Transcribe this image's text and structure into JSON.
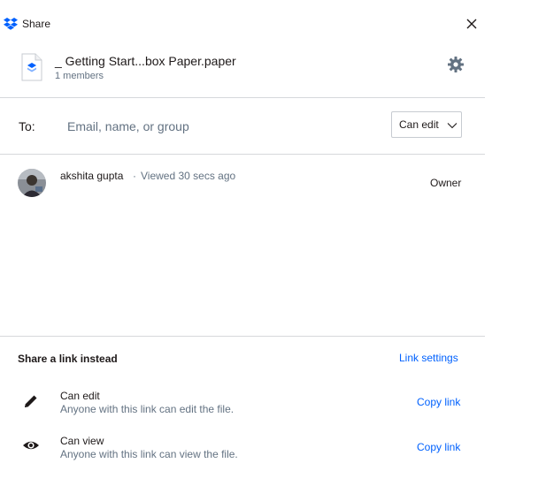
{
  "window": {
    "title": "Share"
  },
  "file": {
    "name": "_ Getting Start...box Paper.paper",
    "members": "1 members"
  },
  "to": {
    "label": "To:",
    "placeholder": "Email, name, or group",
    "permission": "Can edit"
  },
  "members": [
    {
      "name": "akshita gupta",
      "separator": "·",
      "status": "Viewed 30 secs ago",
      "role": "Owner"
    }
  ],
  "link_section": {
    "heading": "Share a link instead",
    "settings_label": "Link settings",
    "options": [
      {
        "title": "Can edit",
        "description": "Anyone with this link can edit the file.",
        "action": "Copy link",
        "icon": "pencil-icon"
      },
      {
        "title": "Can view",
        "description": "Anyone with this link can view the file.",
        "action": "Copy link",
        "icon": "eye-icon"
      }
    ]
  },
  "colors": {
    "accent": "#0061fe",
    "muted": "#637282",
    "divider": "#d6d8db",
    "text": "#1e1919"
  }
}
